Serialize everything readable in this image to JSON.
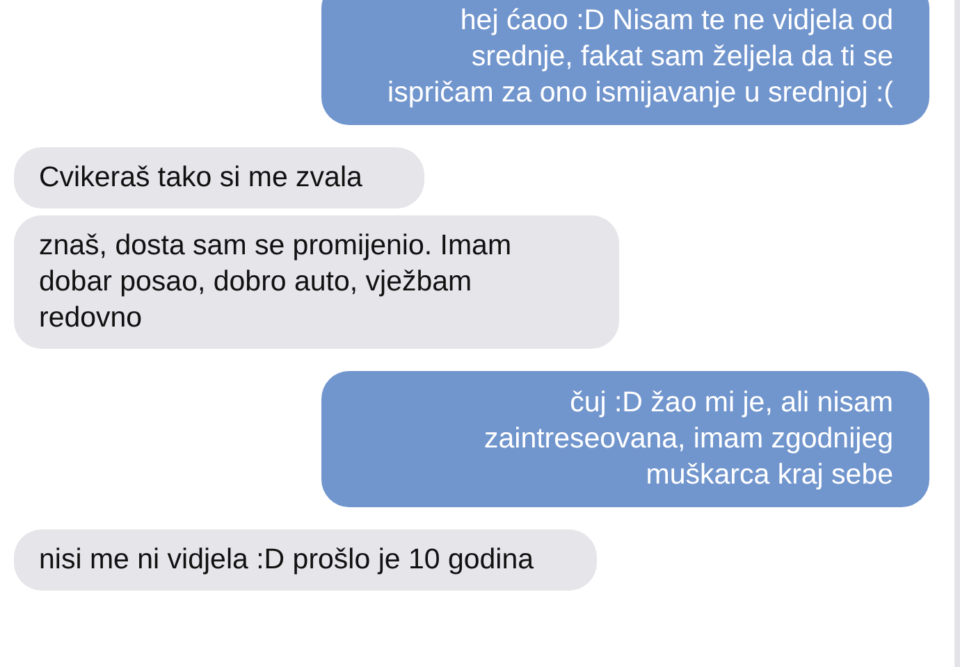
{
  "messages": [
    {
      "kind": "sent",
      "text": "hej ćaoo :D Nisam te ne vidjela od srednje, fakat sam željela da ti se ispričam za ono ismijavanje u srednjoj :("
    },
    {
      "kind": "received",
      "text": "Cvikeraš tako si me zvala"
    },
    {
      "kind": "received",
      "text": "znaš, dosta sam se promijenio. Imam dobar posao, dobro auto, vježbam redovno"
    },
    {
      "kind": "sent",
      "text": "čuj :D žao mi je, ali nisam zaintreseovana, imam zgodnijeg muškarca kraj sebe"
    },
    {
      "kind": "received",
      "text": "nisi me ni vidjela :D prošlo je 10 godina"
    }
  ]
}
